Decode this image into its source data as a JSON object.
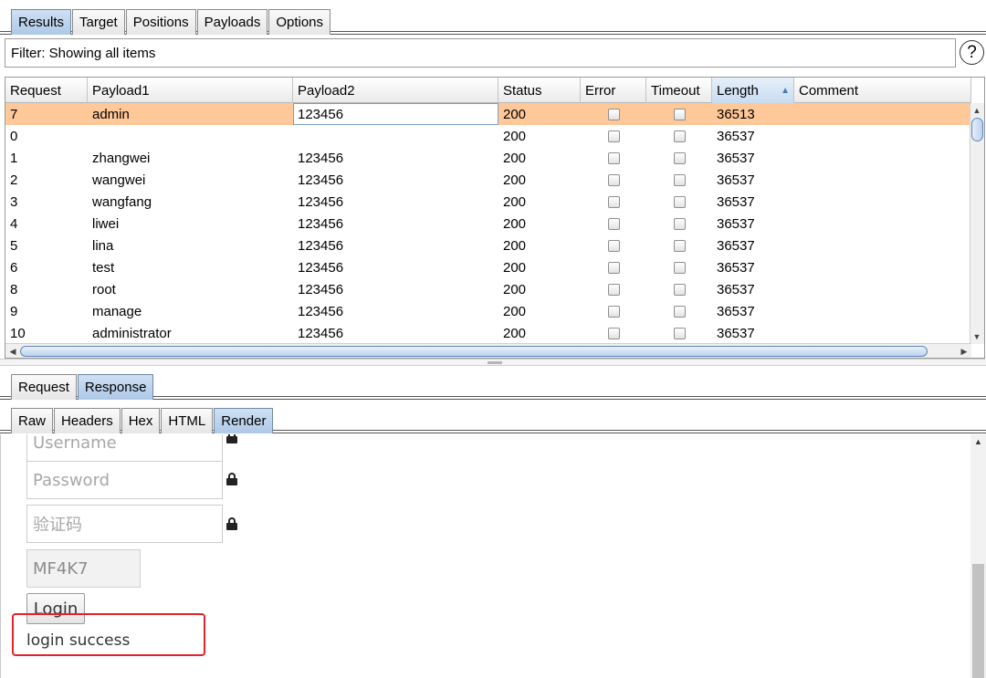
{
  "top_tabs": [
    "Results",
    "Target",
    "Positions",
    "Payloads",
    "Options"
  ],
  "filter": {
    "label": "Filter: Showing all items",
    "help_icon": "?"
  },
  "table": {
    "columns": [
      "Request",
      "Payload1",
      "Payload2",
      "Status",
      "Error",
      "Timeout",
      "Length",
      "Comment"
    ],
    "sorted_column": "Length",
    "rows": [
      {
        "request": "7",
        "payload1": "admin",
        "payload2": "123456",
        "status": "200",
        "error": false,
        "timeout": false,
        "length": "36513",
        "comment": "",
        "selected": true
      },
      {
        "request": "0",
        "payload1": "",
        "payload2": "",
        "status": "200",
        "error": false,
        "timeout": false,
        "length": "36537",
        "comment": ""
      },
      {
        "request": "1",
        "payload1": "zhangwei",
        "payload2": "123456",
        "status": "200",
        "error": false,
        "timeout": false,
        "length": "36537",
        "comment": ""
      },
      {
        "request": "2",
        "payload1": "wangwei",
        "payload2": "123456",
        "status": "200",
        "error": false,
        "timeout": false,
        "length": "36537",
        "comment": ""
      },
      {
        "request": "3",
        "payload1": "wangfang",
        "payload2": "123456",
        "status": "200",
        "error": false,
        "timeout": false,
        "length": "36537",
        "comment": ""
      },
      {
        "request": "4",
        "payload1": "liwei",
        "payload2": "123456",
        "status": "200",
        "error": false,
        "timeout": false,
        "length": "36537",
        "comment": ""
      },
      {
        "request": "5",
        "payload1": "lina",
        "payload2": "123456",
        "status": "200",
        "error": false,
        "timeout": false,
        "length": "36537",
        "comment": ""
      },
      {
        "request": "6",
        "payload1": "test",
        "payload2": "123456",
        "status": "200",
        "error": false,
        "timeout": false,
        "length": "36537",
        "comment": ""
      },
      {
        "request": "8",
        "payload1": "root",
        "payload2": "123456",
        "status": "200",
        "error": false,
        "timeout": false,
        "length": "36537",
        "comment": ""
      },
      {
        "request": "9",
        "payload1": "manage",
        "payload2": "123456",
        "status": "200",
        "error": false,
        "timeout": false,
        "length": "36537",
        "comment": ""
      },
      {
        "request": "10",
        "payload1": "administrator",
        "payload2": "123456",
        "status": "200",
        "error": false,
        "timeout": false,
        "length": "36537",
        "comment": ""
      }
    ]
  },
  "detail_tabs": [
    "Request",
    "Response"
  ],
  "detail_active": "Response",
  "view_tabs": [
    "Raw",
    "Headers",
    "Hex",
    "HTML",
    "Render"
  ],
  "view_active": "Render",
  "render": {
    "username_placeholder": "Username",
    "password_placeholder": "Password",
    "captcha_placeholder": "验证码",
    "captcha_code": "MF4K7",
    "login_button": "Login",
    "result_message": "login success"
  },
  "colors": {
    "selected_row": "#ffc899",
    "active_tab": "#adc8e6",
    "highlight_box": "#e8202a"
  }
}
